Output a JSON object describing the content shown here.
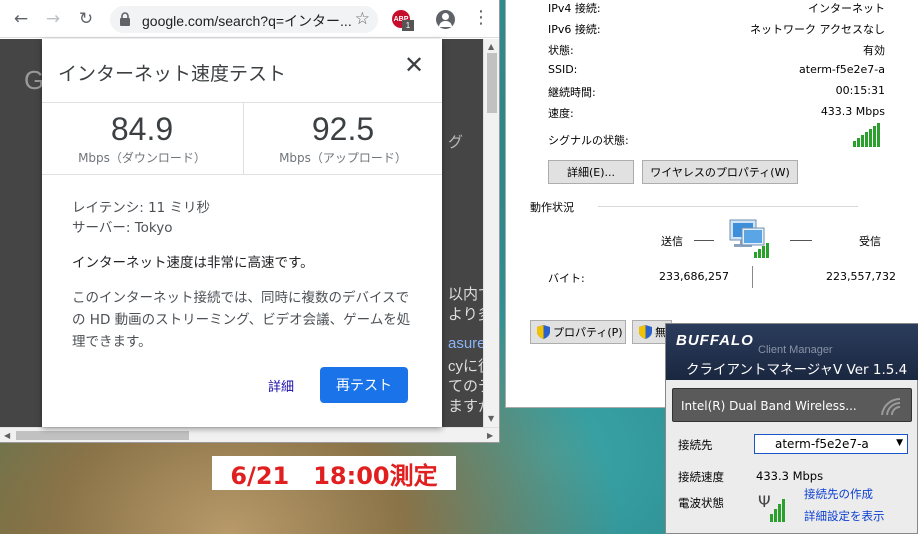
{
  "chrome": {
    "url": "google.com/search?q=インター...",
    "abp_label": "ABP",
    "abp_count": "1",
    "bg_fragments": [
      "G",
      "グ",
      "以内で",
      "より多",
      "asure",
      "cyに従",
      "てのデ",
      "ますが"
    ]
  },
  "speedtest": {
    "title": "インターネット速度テスト",
    "download": {
      "value": "84.9",
      "unit": "Mbps（ダウンロード）"
    },
    "upload": {
      "value": "92.5",
      "unit": "Mbps（アップロード）"
    },
    "latency": "レイテンシ: 11 ミリ秒",
    "server": "サーバー: Tokyo",
    "verdict": "インターネット速度は非常に高速です。",
    "description": "このインターネット接続では、同時に複数のデバイスでの HD 動画のストリーミング、ビデオ会議、ゲームを処理できます。",
    "details_link": "詳細",
    "retest_button": "再テスト"
  },
  "wifi_status": {
    "rows": [
      {
        "label": "IPv4 接続:",
        "value": "インターネット"
      },
      {
        "label": "IPv6 接続:",
        "value": "ネットワーク アクセスなし"
      },
      {
        "label": "状態:",
        "value": "有効"
      },
      {
        "label": "SSID:",
        "value": "aterm-f5e2e7-a"
      },
      {
        "label": "継続時間:",
        "value": "00:15:31"
      },
      {
        "label": "速度:",
        "value": "433.3 Mbps"
      }
    ],
    "signal_label": "シグナルの状態:",
    "details_button": "詳細(E)...",
    "wireless_props_button": "ワイヤレスのプロパティ(W)",
    "activity_label": "動作状況",
    "sent_label": "送信",
    "received_label": "受信",
    "bytes_label": "バイト:",
    "bytes_sent": "233,686,257",
    "bytes_received": "223,557,732",
    "properties_button": "プロパティ(P)",
    "disable_button": "無",
    "accent": "#2ca02c"
  },
  "buffalo": {
    "brand": "BUFFALO",
    "subtitle": "Client Manager",
    "title": "クライアントマネージャV  Ver 1.5.4",
    "adapter": "Intel(R) Dual Band Wireless...",
    "connect_label": "接続先",
    "connect_value": "aterm-f5e2e7-a",
    "speed_label": "接続速度",
    "speed_value": "433.3 Mbps",
    "signal_label": "電波状態",
    "link_connection": "接続先の作成",
    "link_settings": "詳細設定を表示"
  },
  "caption": "6/21　18:00測定"
}
